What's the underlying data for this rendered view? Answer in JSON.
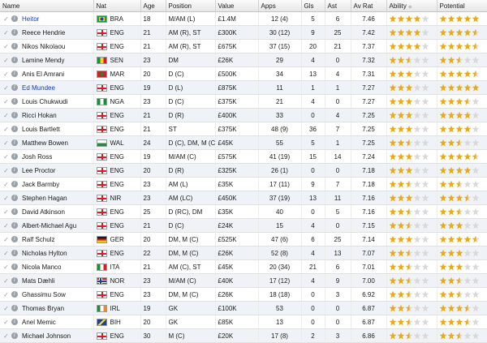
{
  "headers": [
    "Name",
    "Nat",
    "Age",
    "Position",
    "Value",
    "Apps",
    "Gls",
    "Ast",
    "Av Rat",
    "Ability",
    "Potential"
  ],
  "colors": {
    "link": "#1b3bb5",
    "star": "#e9aa13",
    "star_empty": "#d9d9d9",
    "row_alt": "#eff2f6"
  },
  "icons": {
    "check": "check-icon",
    "info": "info-icon",
    "sort": "sort-icon"
  },
  "players": [
    {
      "name": "Heitor",
      "link": true,
      "nat": "BRA",
      "age": "18",
      "pos": "M/AM (L)",
      "value": "£1.4M",
      "apps": "12 (4)",
      "gls": "5",
      "ast": "6",
      "rat": "7.46",
      "ability": 4,
      "potential": 5
    },
    {
      "name": "Reece Hendrie",
      "link": false,
      "nat": "ENG",
      "age": "21",
      "pos": "AM (R), ST",
      "value": "£300K",
      "apps": "30 (12)",
      "gls": "9",
      "ast": "25",
      "rat": "7.42",
      "ability": 4,
      "potential": 4.5
    },
    {
      "name": "Nikos Nikolaou",
      "link": false,
      "nat": "ENG",
      "age": "21",
      "pos": "AM (R), ST",
      "value": "£675K",
      "apps": "37 (15)",
      "gls": "20",
      "ast": "21",
      "rat": "7.37",
      "ability": 4,
      "potential": 4.5
    },
    {
      "name": "Lamine Mendy",
      "link": false,
      "nat": "SEN",
      "age": "23",
      "pos": "DM",
      "value": "£26K",
      "apps": "29",
      "gls": "4",
      "ast": "0",
      "rat": "7.32",
      "ability": 2.5,
      "potential": 2.5
    },
    {
      "name": "Anis El Amrani",
      "link": false,
      "nat": "MAR",
      "age": "20",
      "pos": "D (C)",
      "value": "£500K",
      "apps": "34",
      "gls": "13",
      "ast": "4",
      "rat": "7.31",
      "ability": 3,
      "potential": 4.5
    },
    {
      "name": "Ed Mundee",
      "link": true,
      "nat": "ENG",
      "age": "19",
      "pos": "D (L)",
      "value": "£875K",
      "apps": "11",
      "gls": "1",
      "ast": "1",
      "rat": "7.27",
      "ability": 3,
      "potential": 5
    },
    {
      "name": "Louis Chukwudi",
      "link": false,
      "nat": "NGA",
      "age": "23",
      "pos": "D (C)",
      "value": "£375K",
      "apps": "21",
      "gls": "4",
      "ast": "0",
      "rat": "7.27",
      "ability": 3,
      "potential": 3.5
    },
    {
      "name": "Ricci Hokan",
      "link": false,
      "nat": "ENG",
      "age": "21",
      "pos": "D (R)",
      "value": "£400K",
      "apps": "33",
      "gls": "0",
      "ast": "4",
      "rat": "7.25",
      "ability": 3,
      "potential": 4
    },
    {
      "name": "Louis Bartlett",
      "link": false,
      "nat": "ENG",
      "age": "21",
      "pos": "ST",
      "value": "£375K",
      "apps": "48 (9)",
      "gls": "36",
      "ast": "7",
      "rat": "7.25",
      "ability": 3,
      "potential": 4
    },
    {
      "name": "Matthew Bowen",
      "link": false,
      "nat": "WAL",
      "age": "24",
      "pos": "D (C), DM, M (C)",
      "value": "£45K",
      "apps": "55",
      "gls": "5",
      "ast": "1",
      "rat": "7.25",
      "ability": 2.5,
      "potential": 2.5
    },
    {
      "name": "Josh Ross",
      "link": false,
      "nat": "ENG",
      "age": "19",
      "pos": "M/AM (C)",
      "value": "£575K",
      "apps": "41 (19)",
      "gls": "15",
      "ast": "14",
      "rat": "7.24",
      "ability": 3,
      "potential": 4.5
    },
    {
      "name": "Lee Proctor",
      "link": false,
      "nat": "ENG",
      "age": "20",
      "pos": "D (R)",
      "value": "£325K",
      "apps": "26 (1)",
      "gls": "0",
      "ast": "0",
      "rat": "7.18",
      "ability": 3,
      "potential": 4
    },
    {
      "name": "Jack Barmby",
      "link": false,
      "nat": "ENG",
      "age": "23",
      "pos": "AM (L)",
      "value": "£35K",
      "apps": "17 (11)",
      "gls": "9",
      "ast": "7",
      "rat": "7.18",
      "ability": 2.5,
      "potential": 2.5
    },
    {
      "name": "Stephen Hagan",
      "link": false,
      "nat": "NIR",
      "age": "23",
      "pos": "AM (LC)",
      "value": "£450K",
      "apps": "37 (19)",
      "gls": "13",
      "ast": "11",
      "rat": "7.16",
      "ability": 3,
      "potential": 3.5
    },
    {
      "name": "David Atkinson",
      "link": false,
      "nat": "ENG",
      "age": "25",
      "pos": "D (RC), DM",
      "value": "£35K",
      "apps": "40",
      "gls": "0",
      "ast": "5",
      "rat": "7.16",
      "ability": 2.5,
      "potential": 2.5
    },
    {
      "name": "Albert-Michael Agu",
      "link": false,
      "nat": "ENG",
      "age": "21",
      "pos": "D (C)",
      "value": "£24K",
      "apps": "15",
      "gls": "4",
      "ast": "0",
      "rat": "7.15",
      "ability": 2.5,
      "potential": 3
    },
    {
      "name": "Ralf Schulz",
      "link": false,
      "nat": "GER",
      "age": "20",
      "pos": "DM, M (C)",
      "value": "£525K",
      "apps": "47 (6)",
      "gls": "6",
      "ast": "25",
      "rat": "7.14",
      "ability": 3,
      "potential": 4.5
    },
    {
      "name": "Nicholas Hylton",
      "link": false,
      "nat": "ENG",
      "age": "22",
      "pos": "DM, M (C)",
      "value": "£26K",
      "apps": "52 (8)",
      "gls": "4",
      "ast": "13",
      "rat": "7.07",
      "ability": 2.5,
      "potential": 3
    },
    {
      "name": "Nicola Manco",
      "link": false,
      "nat": "ITA",
      "age": "21",
      "pos": "AM (C), ST",
      "value": "£45K",
      "apps": "20 (34)",
      "gls": "21",
      "ast": "6",
      "rat": "7.01",
      "ability": 2.5,
      "potential": 3
    },
    {
      "name": "Mats Dæhli",
      "link": false,
      "nat": "NOR",
      "age": "23",
      "pos": "M/AM (C)",
      "value": "£40K",
      "apps": "17 (12)",
      "gls": "4",
      "ast": "9",
      "rat": "7.00",
      "ability": 2.5,
      "potential": 2.5
    },
    {
      "name": "Ghassimu Sow",
      "link": false,
      "nat": "ENG",
      "age": "23",
      "pos": "DM, M (C)",
      "value": "£26K",
      "apps": "18 (18)",
      "gls": "0",
      "ast": "3",
      "rat": "6.92",
      "ability": 2.5,
      "potential": 2.5
    },
    {
      "name": "Thomas Bryan",
      "link": false,
      "nat": "IRL",
      "age": "19",
      "pos": "GK",
      "value": "£100K",
      "apps": "53",
      "gls": "0",
      "ast": "0",
      "rat": "6.87",
      "ability": 2.5,
      "potential": 3.5
    },
    {
      "name": "Anel Memic",
      "link": false,
      "nat": "BIH",
      "age": "20",
      "pos": "GK",
      "value": "£85K",
      "apps": "13",
      "gls": "0",
      "ast": "0",
      "rat": "6.87",
      "ability": 2.5,
      "potential": 3.5
    },
    {
      "name": "Michael Johnson",
      "link": false,
      "nat": "ENG",
      "age": "30",
      "pos": "M (C)",
      "value": "£20K",
      "apps": "17 (8)",
      "gls": "2",
      "ast": "3",
      "rat": "6.86",
      "ability": 2.5,
      "potential": 2.5
    }
  ]
}
